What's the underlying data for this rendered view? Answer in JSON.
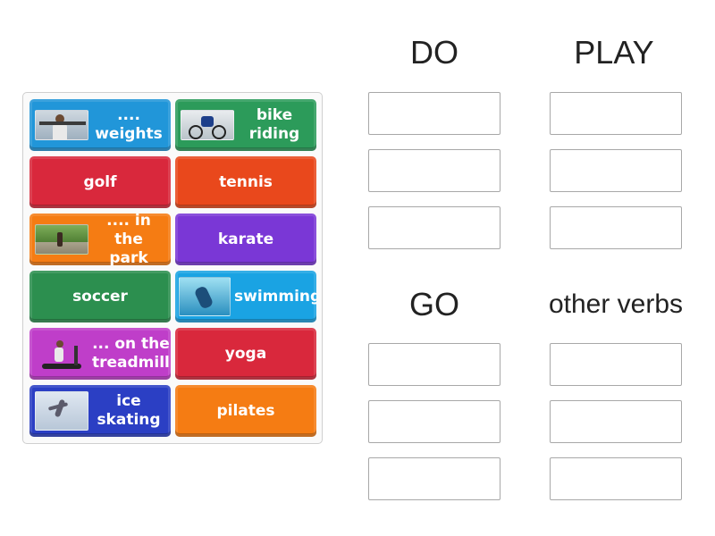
{
  "colors": {
    "blue": "#2196d9",
    "green": "#2c9b5a",
    "red": "#d9283c",
    "orange_red": "#e9481c",
    "orange": "#f57c13",
    "purple": "#7a37d6",
    "magenta": "#bf3ec9",
    "navy": "#2b3fc4",
    "cyan": "#1aa3e3"
  },
  "tiles": [
    {
      "label": "....\nweights",
      "color": "#2196d9",
      "icon": "weights-photo"
    },
    {
      "label": "bike\nriding",
      "color": "#2c9b5a",
      "icon": "bike-photo"
    },
    {
      "label": "golf",
      "color": "#d9283c"
    },
    {
      "label": "tennis",
      "color": "#e9481c"
    },
    {
      "label": ".... in the\npark",
      "color": "#f57c13",
      "icon": "park-photo"
    },
    {
      "label": "karate",
      "color": "#7a37d6"
    },
    {
      "label": "soccer",
      "color": "#2c8f4f"
    },
    {
      "label": "swimming",
      "color": "#1aa3e3",
      "icon": "swimming-photo"
    },
    {
      "label": "... on the\ntreadmill",
      "color": "#bf3ec9",
      "icon": "treadmill-photo"
    },
    {
      "label": "yoga",
      "color": "#d9283c"
    },
    {
      "label": "ice\nskating",
      "color": "#2b3fc4",
      "icon": "skating-photo"
    },
    {
      "label": "pilates",
      "color": "#f57c13"
    }
  ],
  "groups": [
    {
      "title": "DO"
    },
    {
      "title": "PLAY"
    },
    {
      "title": "GO"
    },
    {
      "title": "other verbs"
    }
  ]
}
